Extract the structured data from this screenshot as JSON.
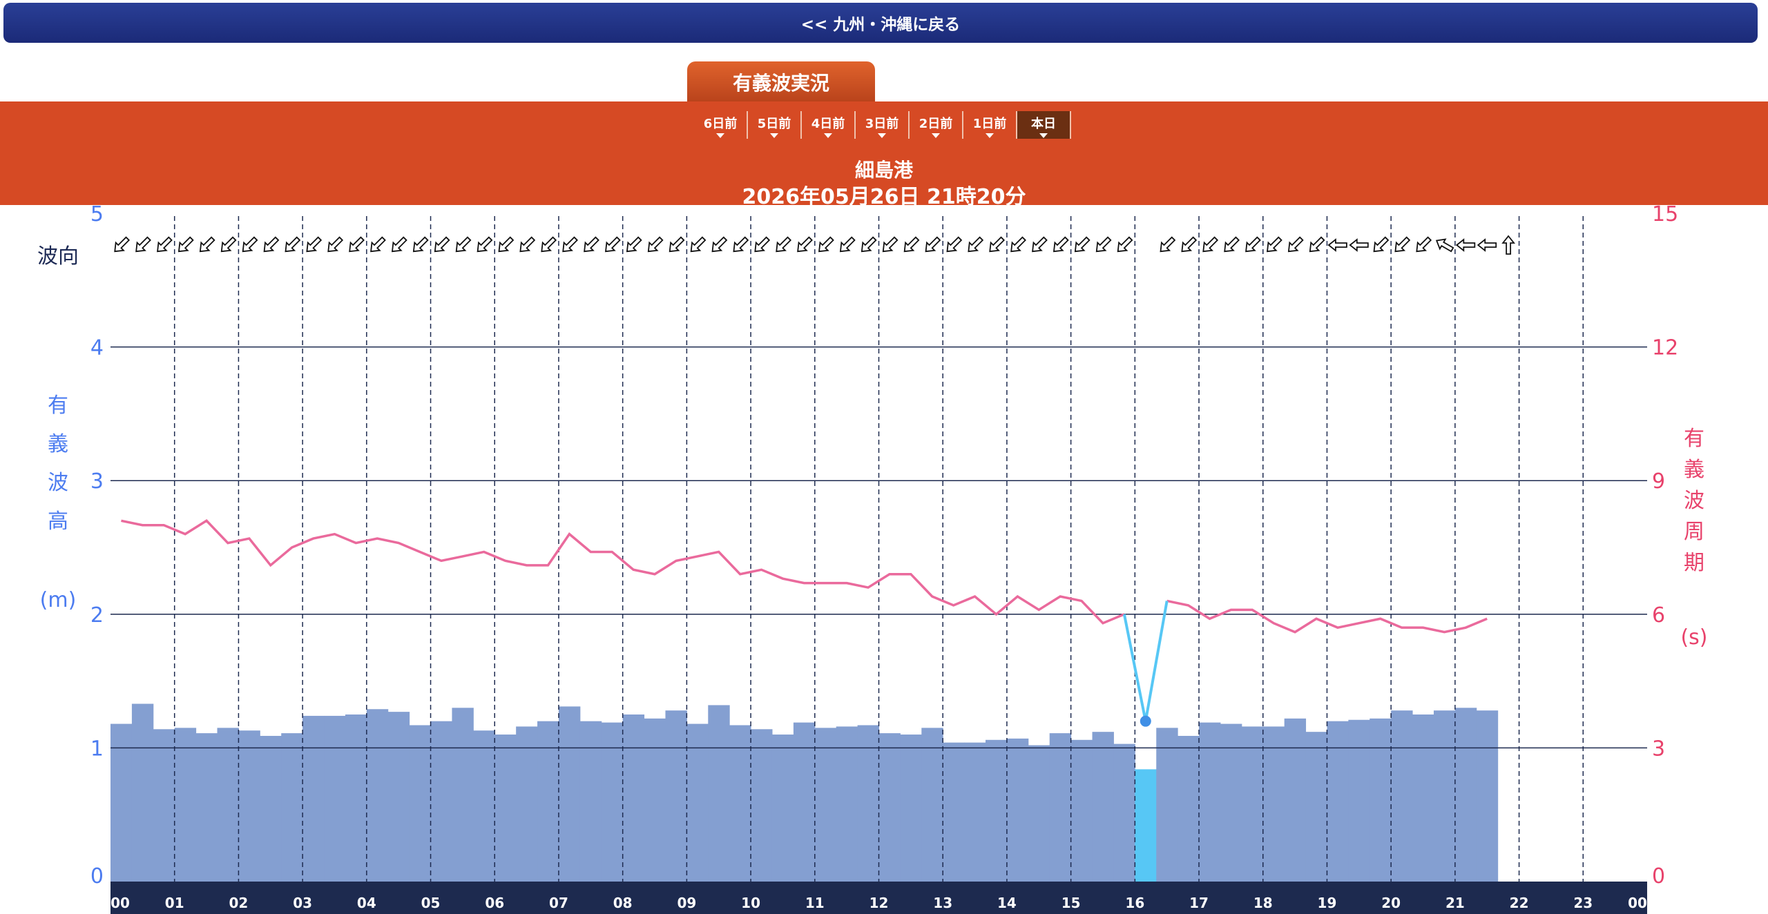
{
  "nav": {
    "back_label": "<< 九州・沖縄に戻る"
  },
  "header": {
    "title_tab": "有義波実況",
    "day_tabs": [
      "6日前",
      "5日前",
      "4日前",
      "3日前",
      "2日前",
      "1日前",
      "本日"
    ],
    "active_tab": "本日",
    "station": "細島港",
    "timestamp": "2026年05月26日 21時20分"
  },
  "colors": {
    "bar": "#849fd1",
    "bar_highlight": "#57c7f5",
    "period_line": "#ea6a9c",
    "highlight_line": "#57c7f5",
    "axis_band": "#1d2a4f",
    "left_axis": "#4c7cf0",
    "right_axis": "#e8426b"
  },
  "chart_data": {
    "type": "bar+line",
    "left_axis": {
      "label_chars": [
        "有",
        "義",
        "波",
        "高"
      ],
      "unit": "(m)",
      "ticks": [
        "0",
        "1",
        "2",
        "3",
        "4",
        "5"
      ],
      "ylim": [
        0,
        5
      ]
    },
    "right_axis": {
      "label_chars": [
        "有",
        "義",
        "波",
        "周",
        "期"
      ],
      "unit": "(s)",
      "ticks": [
        "0",
        "3",
        "6",
        "9",
        "12",
        "15"
      ],
      "ylim": [
        0,
        15
      ]
    },
    "direction_label": "波向",
    "x_ticks": [
      "00",
      "01",
      "02",
      "03",
      "04",
      "05",
      "06",
      "07",
      "08",
      "09",
      "10",
      "11",
      "12",
      "13",
      "14",
      "15",
      "16",
      "17",
      "18",
      "19",
      "20",
      "21",
      "22",
      "23",
      "00"
    ],
    "interval_minutes": 20,
    "wave_height_m": [
      1.18,
      1.33,
      1.14,
      1.15,
      1.11,
      1.15,
      1.13,
      1.09,
      1.11,
      1.24,
      1.24,
      1.25,
      1.29,
      1.27,
      1.17,
      1.2,
      1.3,
      1.13,
      1.1,
      1.16,
      1.2,
      1.31,
      1.2,
      1.19,
      1.25,
      1.22,
      1.28,
      1.18,
      1.32,
      1.17,
      1.14,
      1.1,
      1.19,
      1.15,
      1.16,
      1.17,
      1.11,
      1.1,
      1.15,
      1.04,
      1.04,
      1.06,
      1.07,
      1.02,
      1.11,
      1.06,
      1.12,
      1.03,
      0.84,
      1.15,
      1.09,
      1.19,
      1.18,
      1.16,
      1.16,
      1.22,
      1.12,
      1.2,
      1.21,
      1.22,
      1.28,
      1.25,
      1.28,
      1.3,
      1.28
    ],
    "wave_period_s": [
      8.1,
      8.0,
      8.0,
      7.8,
      8.1,
      7.6,
      7.7,
      7.1,
      7.5,
      7.7,
      7.8,
      7.6,
      7.7,
      7.6,
      7.4,
      7.2,
      7.3,
      7.4,
      7.2,
      7.1,
      7.1,
      7.8,
      7.4,
      7.4,
      7.0,
      6.9,
      7.2,
      7.3,
      7.4,
      6.9,
      7.0,
      6.8,
      6.7,
      6.7,
      6.7,
      6.6,
      6.9,
      6.9,
      6.4,
      6.2,
      6.4,
      6.0,
      6.4,
      6.1,
      6.4,
      6.3,
      5.8,
      6.0,
      3.6,
      6.3,
      6.2,
      5.9,
      6.1,
      6.1,
      5.8,
      5.6,
      5.9,
      5.7,
      5.8,
      5.9,
      5.7,
      5.7,
      5.6,
      5.7,
      5.9
    ],
    "highlighted_index": 48,
    "direction_deg": [
      225,
      225,
      225,
      225,
      225,
      225,
      225,
      225,
      225,
      225,
      225,
      225,
      225,
      225,
      225,
      225,
      225,
      225,
      225,
      225,
      225,
      225,
      225,
      225,
      225,
      225,
      225,
      225,
      225,
      225,
      225,
      225,
      225,
      225,
      225,
      225,
      225,
      225,
      225,
      225,
      225,
      225,
      225,
      225,
      225,
      225,
      225,
      225,
      null,
      225,
      225,
      225,
      225,
      225,
      225,
      225,
      225,
      270,
      270,
      225,
      225,
      225,
      300,
      270,
      270,
      0
    ]
  }
}
